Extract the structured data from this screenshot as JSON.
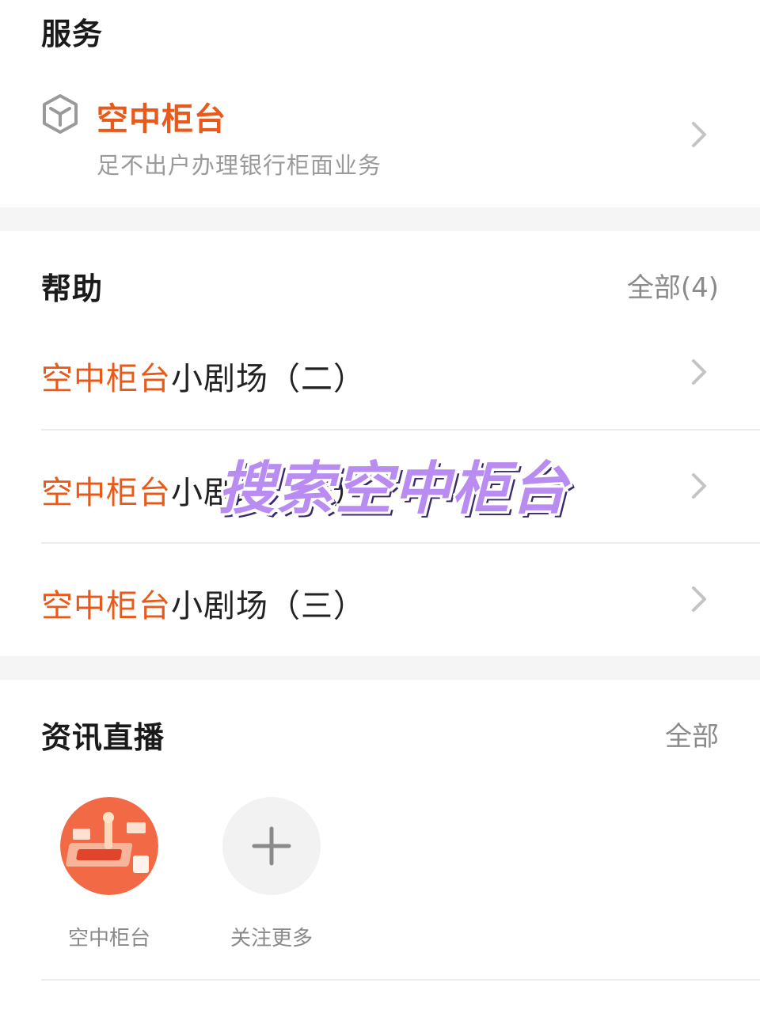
{
  "service": {
    "title": "服务",
    "item": {
      "name": "空中柜台",
      "subtitle": "足不出户办理银行柜面业务",
      "icon": "cube-icon"
    }
  },
  "help": {
    "title": "帮助",
    "all_link": "全部(4)",
    "items": [
      {
        "highlight": "空中柜台",
        "rest": "小剧场（二）"
      },
      {
        "highlight": "空中柜台",
        "rest": "小剧场（一）"
      },
      {
        "highlight": "空中柜台",
        "rest": "小剧场（三）"
      }
    ]
  },
  "news": {
    "title": "资讯直播",
    "all_link": "全部",
    "channels": [
      {
        "label": "空中柜台",
        "icon": "counter-illustration-icon"
      },
      {
        "label": "关注更多",
        "icon": "plus-icon"
      }
    ]
  },
  "overlay_text": "搜索空中柜台",
  "colors": {
    "accent": "#e8591a",
    "secondary_text": "#9a9a9a",
    "section_gap": "#f5f5f5",
    "overlay": "#b98cf2"
  }
}
